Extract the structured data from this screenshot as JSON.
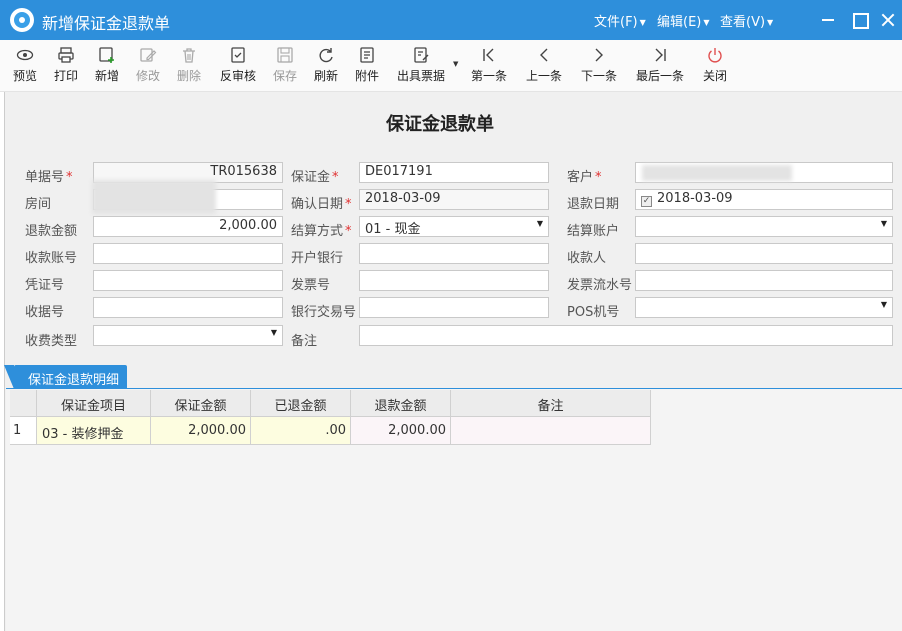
{
  "window": {
    "title": "新增保证金退款单",
    "menus": [
      {
        "label": "文件(F)"
      },
      {
        "label": "编辑(E)"
      },
      {
        "label": "查看(V)"
      }
    ]
  },
  "toolbar": {
    "preview": "预览",
    "print": "打印",
    "new": "新增",
    "edit": "修改",
    "delete": "删除",
    "unaudit": "反审核",
    "save": "保存",
    "refresh": "刷新",
    "attachment": "附件",
    "issue_invoice": "出具票据",
    "first": "第一条",
    "prev": "上一条",
    "next": "下一条",
    "last": "最后一条",
    "close": "关闭"
  },
  "form": {
    "title": "保证金退款单",
    "doc_no": {
      "label": "单据号",
      "value": "TR015638"
    },
    "deposit": {
      "label": "保证金",
      "value": "DE017191"
    },
    "customer": {
      "label": "客户",
      "value": ""
    },
    "room": {
      "label": "房间",
      "value": ""
    },
    "confirm_date": {
      "label": "确认日期",
      "value": "2018-03-09"
    },
    "refund_date": {
      "label": "退款日期",
      "value": "2018-03-09",
      "checked": true
    },
    "refund_amount": {
      "label": "退款金额",
      "value": "2,000.00"
    },
    "settle_method": {
      "label": "结算方式",
      "value": "01 - 现金"
    },
    "settle_account": {
      "label": "结算账户",
      "value": ""
    },
    "receive_account": {
      "label": "收款账号",
      "value": ""
    },
    "bank": {
      "label": "开户银行",
      "value": ""
    },
    "payee": {
      "label": "收款人",
      "value": ""
    },
    "voucher_no": {
      "label": "凭证号",
      "value": ""
    },
    "invoice_no": {
      "label": "发票号",
      "value": ""
    },
    "invoice_serial": {
      "label": "发票流水号",
      "value": ""
    },
    "receipt_no": {
      "label": "收据号",
      "value": ""
    },
    "bank_txn_no": {
      "label": "银行交易号",
      "value": ""
    },
    "pos_no": {
      "label": "POS机号",
      "value": ""
    },
    "fee_type": {
      "label": "收费类型",
      "value": ""
    },
    "remark": {
      "label": "备注",
      "value": ""
    }
  },
  "detail": {
    "tab_label": "保证金退款明细",
    "columns": [
      "保证金项目",
      "保证金额",
      "已退金额",
      "退款金额",
      "备注"
    ],
    "rows": [
      {
        "index": "1",
        "item": "03 - 装修押金",
        "amount": "2,000.00",
        "refunded": ".00",
        "refund": "2,000.00",
        "remark": ""
      }
    ]
  },
  "colors": {
    "accent": "#2e8fdb",
    "required": "#e03030",
    "close_icon": "#e05050"
  }
}
